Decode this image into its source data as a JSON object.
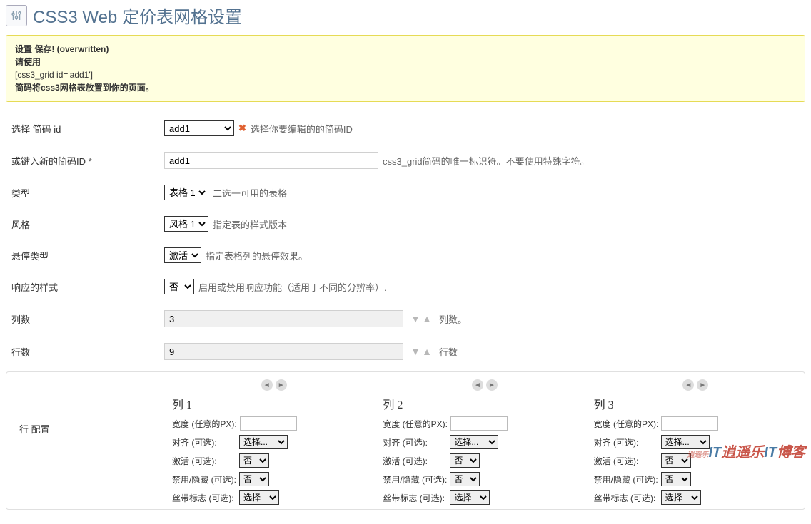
{
  "header": {
    "title": "CSS3 Web 定价表网格设置"
  },
  "notice": {
    "line1_bold": "设置 保存! (overwritten)",
    "line2_bold": "请使用",
    "line3": "[css3_grid id='add1']",
    "line4_bold": "简码将css3网格表放置到你的页面。"
  },
  "form": {
    "select_id": {
      "label": "选择 简码 id",
      "value": "add1",
      "hint": "选择你要编辑的的简码ID"
    },
    "new_id": {
      "label": "或键入新的简码ID *",
      "value": "add1",
      "hint": "css3_grid简码的唯一标识符。不要使用特殊字符。"
    },
    "type": {
      "label": "类型",
      "value": "表格 1",
      "hint": "二选一可用的表格"
    },
    "style": {
      "label": "风格",
      "value": "风格 1",
      "hint": "指定表的样式版本"
    },
    "hover": {
      "label": "悬停类型",
      "value": "激活",
      "hint": "指定表格列的悬停效果。"
    },
    "responsive": {
      "label": "响应的样式",
      "value": "否",
      "hint": "启用或禁用响应功能（适用于不同的分辨率）."
    },
    "cols": {
      "label": "列数",
      "value": "3",
      "hint": "列数。"
    },
    "rows": {
      "label": "行数",
      "value": "9",
      "hint": "行数"
    }
  },
  "row_config_label": "行 配置",
  "col_labels": {
    "width": "宽度 (任意的PX):",
    "align": "对齐 (可选):",
    "active": "激活 (可选):",
    "disable": "禁用/隐藏 (可选):",
    "ribbon": "丝带标志 (可选):"
  },
  "col_values": {
    "align": "选择...",
    "active": "否",
    "disable": "否",
    "ribbon": "选择"
  },
  "columns": [
    {
      "title": "列 1"
    },
    {
      "title": "列 2"
    },
    {
      "title": "列 3"
    }
  ],
  "watermark": "逍遥乐IT博客"
}
